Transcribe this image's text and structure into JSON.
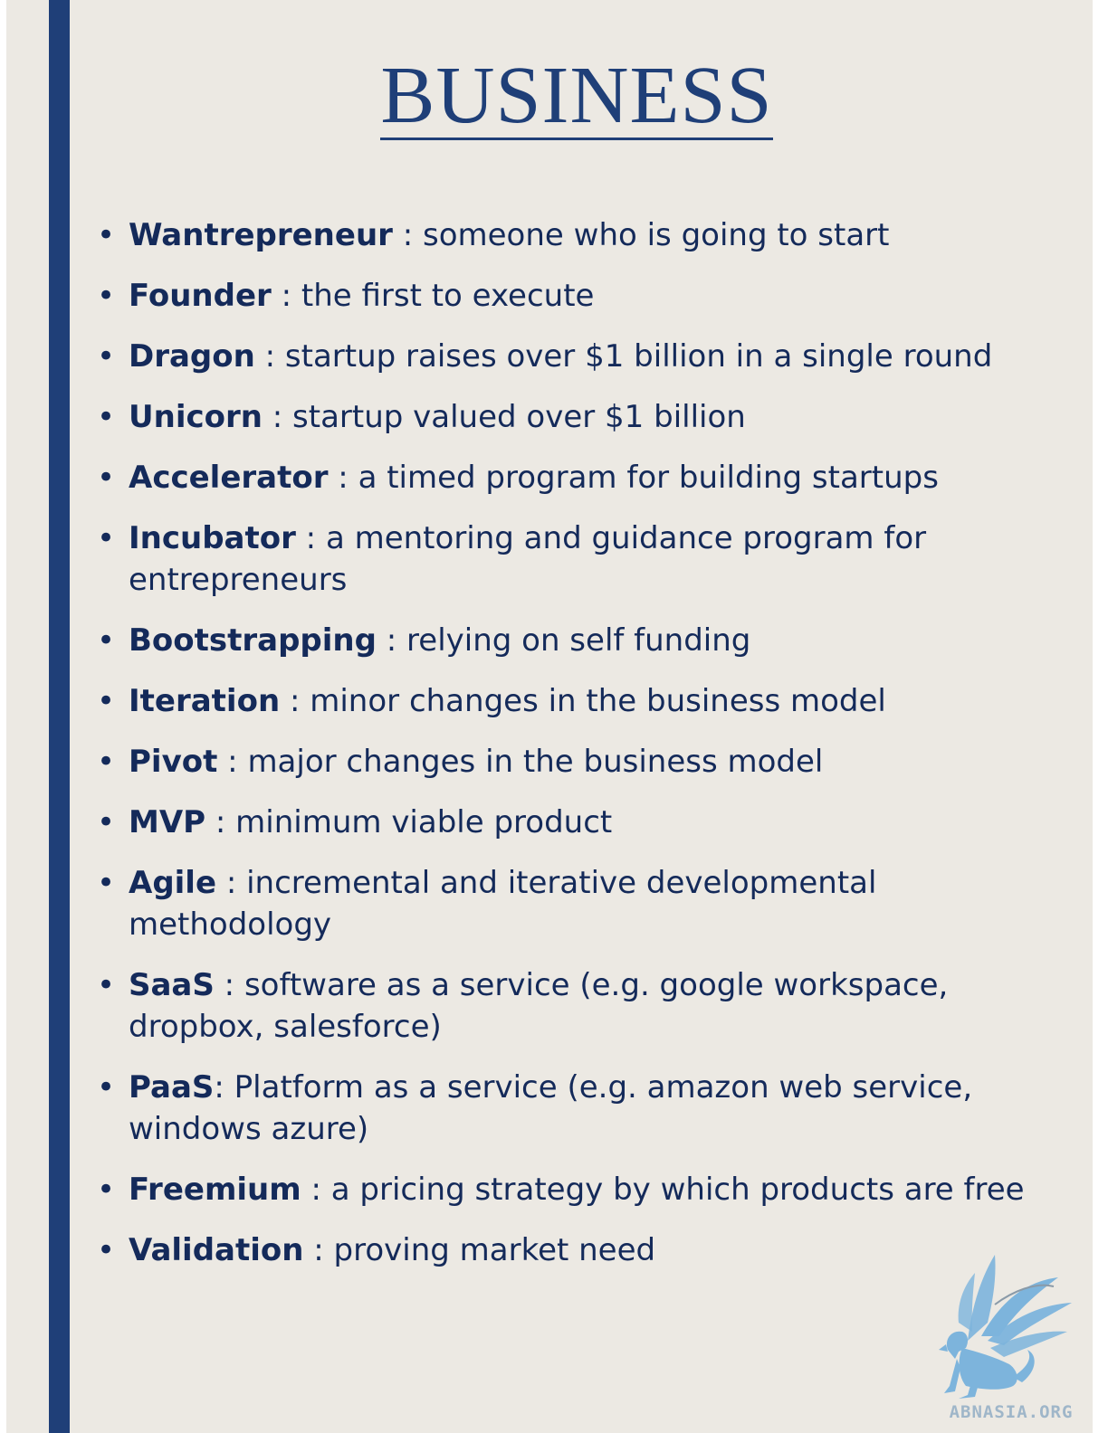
{
  "title": "BUSINESS",
  "terms": [
    {
      "term": "Wantrepreneur",
      "sep": " : ",
      "definition": "someone who is going to start"
    },
    {
      "term": "Founder",
      "sep": " : ",
      "definition": "the first to execute"
    },
    {
      "term": "Dragon",
      "sep": " : ",
      "definition": "startup raises over $1 billion in a single round"
    },
    {
      "term": "Unicorn",
      "sep": " : ",
      "definition": "startup valued over $1 billion"
    },
    {
      "term": "Accelerator",
      "sep": " : ",
      "definition": "a timed program for building startups"
    },
    {
      "term": "Incubator",
      "sep": " : ",
      "definition": "a mentoring and guidance program for entrepreneurs"
    },
    {
      "term": "Bootstrapping",
      "sep": " : ",
      "definition": "relying on self funding"
    },
    {
      "term": "Iteration",
      "sep": " : ",
      "definition": "minor changes in the business model"
    },
    {
      "term": "Pivot",
      "sep": " : ",
      "definition": "major changes in the business model"
    },
    {
      "term": "MVP",
      "sep": " : ",
      "definition": "minimum viable product"
    },
    {
      "term": "Agile",
      "sep": " : ",
      "definition": "incremental and iterative developmental methodology"
    },
    {
      "term": "SaaS",
      "sep": " : ",
      "definition": "software as a service (e.g. google workspace, dropbox, salesforce)"
    },
    {
      "term": "PaaS",
      "sep": ": ",
      "definition": "Platform as a service (e.g. amazon web service, windows azure)"
    },
    {
      "term": "Freemium",
      "sep": " : ",
      "definition": "a pricing strategy by which products are free"
    },
    {
      "term": "Validation",
      "sep": " : ",
      "definition": "proving market need"
    }
  ],
  "bullet_char": "•",
  "logo": {
    "icon": "griffin-logo-icon",
    "text": "ABNASIA.ORG"
  },
  "colors": {
    "accent": "#1f3f78",
    "text": "#142a5a",
    "background": "#ece9e3",
    "logo": "#7db4dc"
  }
}
